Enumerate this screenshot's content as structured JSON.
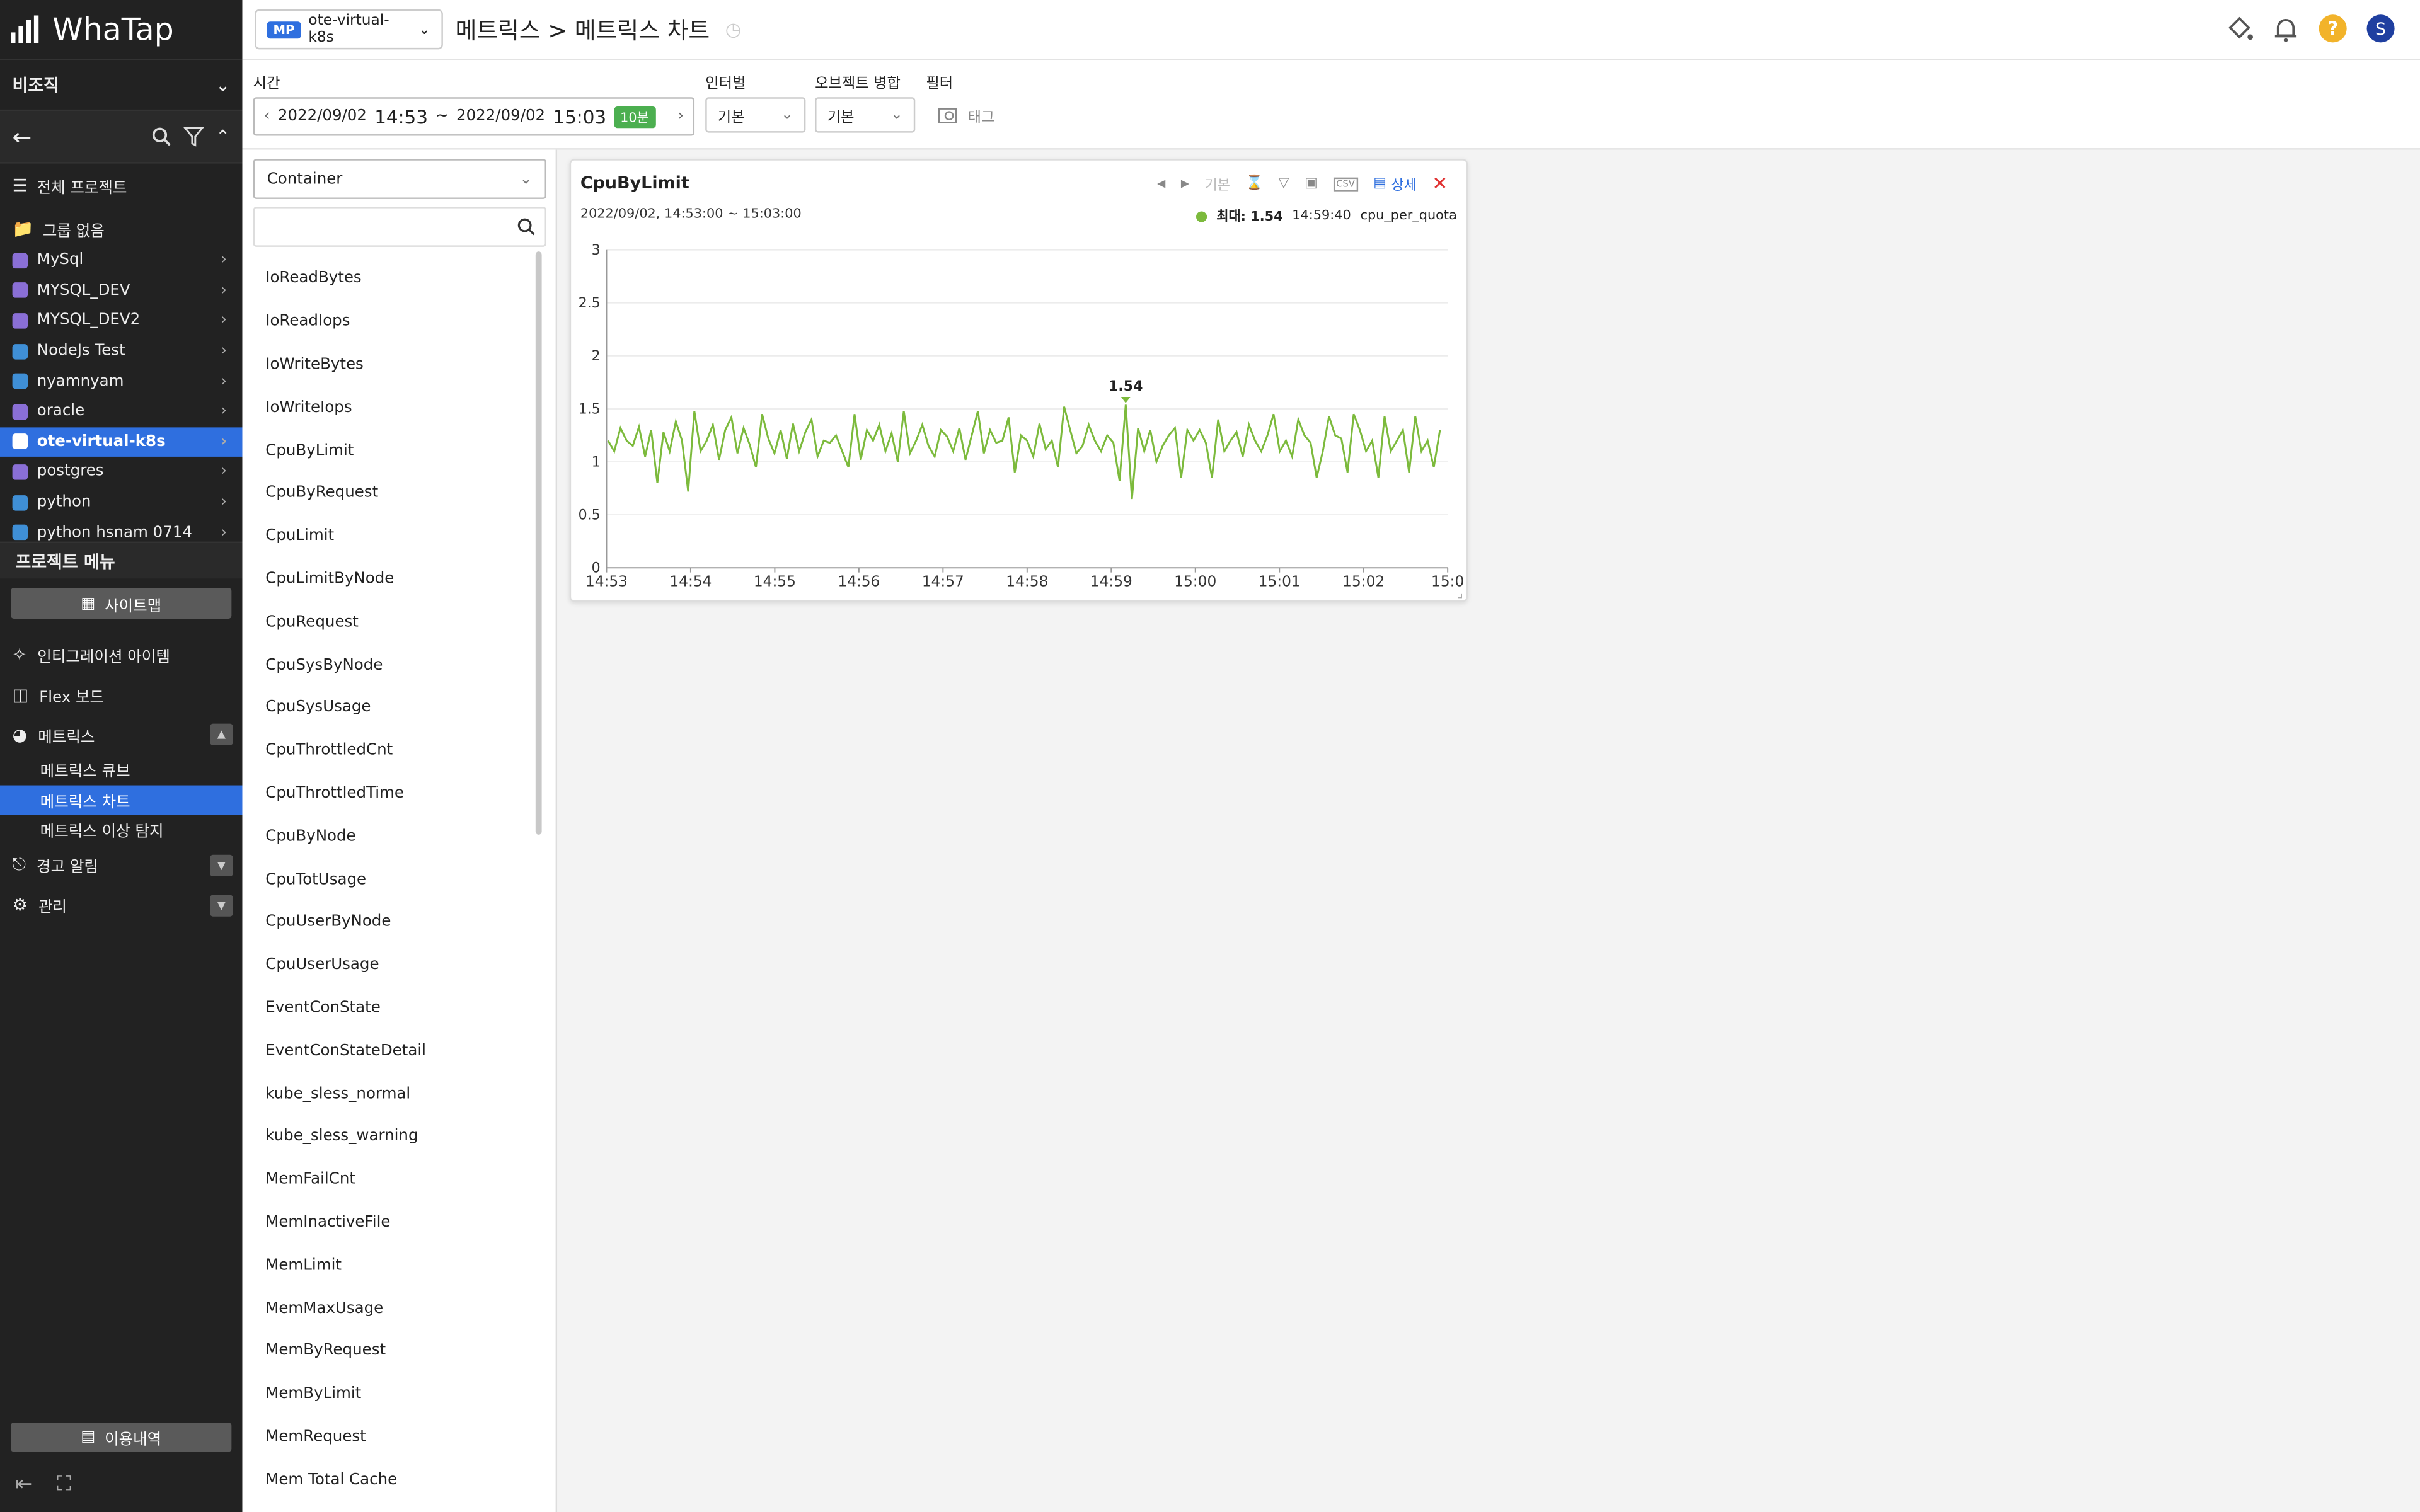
{
  "app": {
    "logo": "WhaTap"
  },
  "sidebar": {
    "org": "비조직",
    "projects": [
      {
        "label": "전체 프로젝트",
        "icon": "layers-icon"
      },
      {
        "label": "그룹 없음",
        "icon": "folder-icon"
      },
      {
        "label": "MySql",
        "icon": "database-icon"
      },
      {
        "label": "MYSQL_DEV",
        "icon": "database-icon"
      },
      {
        "label": "MYSQL_DEV2",
        "icon": "database-icon"
      },
      {
        "label": "NodeJs Test",
        "icon": "code-icon"
      },
      {
        "label": "nyamnyam",
        "icon": "code-icon"
      },
      {
        "label": "oracle",
        "icon": "database-icon"
      },
      {
        "label": "ote-virtual-k8s",
        "icon": "kubernetes-icon",
        "active": true
      },
      {
        "label": "postgres",
        "icon": "database-icon"
      },
      {
        "label": "python",
        "icon": "code-icon"
      },
      {
        "label": "python hsnam 0714",
        "icon": "code-icon"
      }
    ],
    "project_menu_title": "프로젝트 메뉴",
    "sitemap_label": "사이트맵",
    "menus": {
      "integration": "인티그레이션 아이템",
      "flex": "Flex 보드",
      "metrics": "메트릭스",
      "metrics_sub": [
        "메트릭스 큐브",
        "메트릭스 차트",
        "메트릭스 이상 탐지"
      ],
      "alert": "경고 알림",
      "manage": "관리"
    },
    "usage_label": "이용내역"
  },
  "topbar": {
    "project_badge": "MP",
    "project_name": "ote-virtual-k8s",
    "breadcrumb": "메트릭스 > 메트릭스 차트"
  },
  "filters": {
    "time_label": "시간",
    "start_date": "2022/09/02",
    "start_time": "14:53",
    "sep": "~",
    "end_date": "2022/09/02",
    "end_time": "15:03",
    "duration": "10분",
    "interval_label": "인터벌",
    "interval_value": "기본",
    "merge_label": "오브젝트 병합",
    "merge_value": "기본",
    "filter_label": "필터",
    "tag_label": "태그"
  },
  "left": {
    "category": "Container",
    "metrics": [
      "IoReadBytes",
      "IoReadIops",
      "IoWriteBytes",
      "IoWriteIops",
      "CpuByLimit",
      "CpuByRequest",
      "CpuLimit",
      "CpuLimitByNode",
      "CpuRequest",
      "CpuSysByNode",
      "CpuSysUsage",
      "CpuThrottledCnt",
      "CpuThrottledTime",
      "CpuByNode",
      "CpuTotUsage",
      "CpuUserByNode",
      "CpuUserUsage",
      "EventConState",
      "EventConStateDetail",
      "kube_sless_normal",
      "kube_sless_warning",
      "MemFailCnt",
      "MemInactiveFile",
      "MemLimit",
      "MemMaxUsage",
      "MemByRequest",
      "MemByLimit",
      "MemRequest",
      "Mem Total Cache"
    ]
  },
  "card": {
    "title": "CpuByLimit",
    "tool_default": "기본",
    "detail_label": "상세",
    "range": "2022/09/02, 14:53:00 ~ 15:03:00",
    "legend_max": "최대: 1.54",
    "legend_time": "14:59:40",
    "legend_name": "cpu_per_quota"
  },
  "chart_data": {
    "type": "line",
    "ylim": [
      0,
      3
    ],
    "yticks": [
      "0",
      "0.5",
      "1",
      "1.5",
      "2",
      "2.5",
      "3"
    ],
    "xticks": [
      "14:53",
      "14:54",
      "14:55",
      "14:56",
      "14:57",
      "14:58",
      "14:59",
      "15:00",
      "15:01",
      "15:02",
      "15:0"
    ],
    "series": [
      {
        "name": "cpu_per_quota",
        "color": "#7cba3c",
        "values": [
          1.2,
          1.1,
          1.32,
          1.2,
          1.15,
          1.33,
          1.05,
          1.3,
          0.8,
          1.28,
          1.1,
          1.38,
          1.2,
          0.72,
          1.48,
          1.1,
          1.2,
          1.35,
          1.02,
          1.3,
          1.42,
          1.08,
          1.32,
          1.16,
          0.95,
          1.45,
          1.22,
          1.08,
          1.3,
          1.03,
          1.36,
          1.1,
          1.28,
          1.4,
          1.05,
          1.2,
          1.18,
          1.25,
          1.1,
          0.95,
          1.45,
          1.02,
          1.3,
          1.2,
          1.35,
          1.1,
          1.27,
          1.0,
          1.48,
          1.08,
          1.2,
          1.35,
          1.15,
          1.05,
          1.3,
          1.24,
          1.1,
          1.32,
          1.02,
          1.25,
          1.48,
          1.08,
          1.3,
          1.18,
          1.2,
          1.42,
          0.9,
          1.25,
          1.2,
          1.05,
          1.36,
          1.12,
          1.2,
          0.95,
          1.52,
          1.3,
          1.08,
          1.15,
          1.35,
          1.2,
          1.1,
          1.25,
          1.18,
          0.82,
          1.54,
          0.65,
          1.32,
          1.1,
          1.3,
          1.0,
          1.15,
          1.25,
          1.32,
          0.85,
          1.3,
          1.2,
          1.3,
          1.18,
          0.85,
          1.4,
          1.1,
          1.2,
          1.28,
          1.05,
          1.35,
          1.2,
          1.1,
          1.25,
          1.45,
          1.1,
          1.2,
          1.05,
          1.4,
          1.25,
          1.18,
          0.85,
          1.1,
          1.43,
          1.25,
          1.22,
          0.9,
          1.45,
          1.3,
          1.1,
          1.2,
          0.85,
          1.43,
          1.1,
          1.2,
          1.3,
          0.9,
          1.43,
          1.1,
          1.2,
          0.95,
          1.3
        ],
        "max_label": "1.54"
      }
    ]
  }
}
